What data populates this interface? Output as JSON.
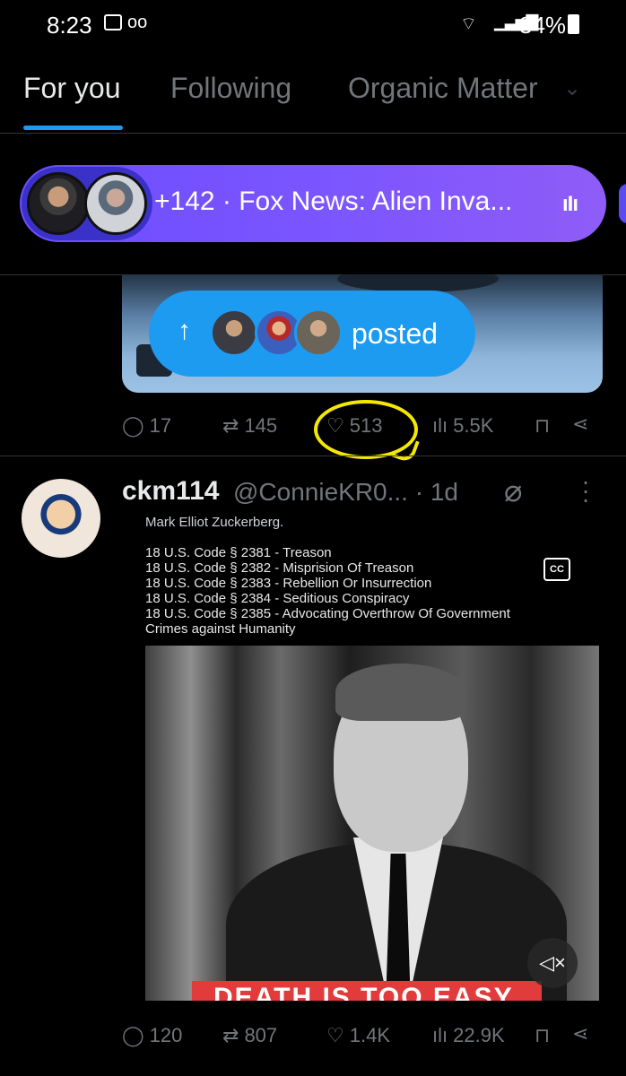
{
  "status_bar": {
    "time": "8:23",
    "voicemail": "oo",
    "battery": "84%"
  },
  "tabs": [
    {
      "label": "For you",
      "active": true
    },
    {
      "label": "Following",
      "active": false
    },
    {
      "label": "Organic Matter",
      "active": false
    }
  ],
  "spaces_pill": {
    "text": "+142 · Fox News: Alien Inva...",
    "icon": "audio-bars-icon"
  },
  "posted_pill": {
    "label": "posted",
    "icon": "arrow-up-icon"
  },
  "tweet1": {
    "actions": {
      "replies": "17",
      "retweets": "145",
      "likes": "513",
      "views": "5.5K"
    }
  },
  "tweet2": {
    "username": "ckm114",
    "handle": "@ConnieKR0...",
    "time": "· 1d",
    "video_text_cut": "Mark Elliot Zuckerberg.",
    "video_text": [
      "18 U.S. Code § 2381 - Treason",
      "18 U.S. Code § 2382 - Misprision Of Treason",
      "18 U.S. Code § 2383 - Rebellion Or Insurrection",
      "18 U.S. Code § 2384 - Seditious Conspiracy",
      "18 U.S. Code § 2385 - Advocating Overthrow Of Government",
      "Crimes against Humanity"
    ],
    "cc_label": "CC",
    "banner": "DEATH IS TOO EASY",
    "actions": {
      "replies": "120",
      "retweets": "807",
      "likes": "1.4K",
      "views": "22.9K"
    }
  },
  "colors": {
    "accent": "#1d9bf0",
    "pill_gradient_start": "#6e4dff",
    "pill_gradient_end": "#8f5cf7",
    "highlight": "#f5e800",
    "background": "#000000"
  }
}
